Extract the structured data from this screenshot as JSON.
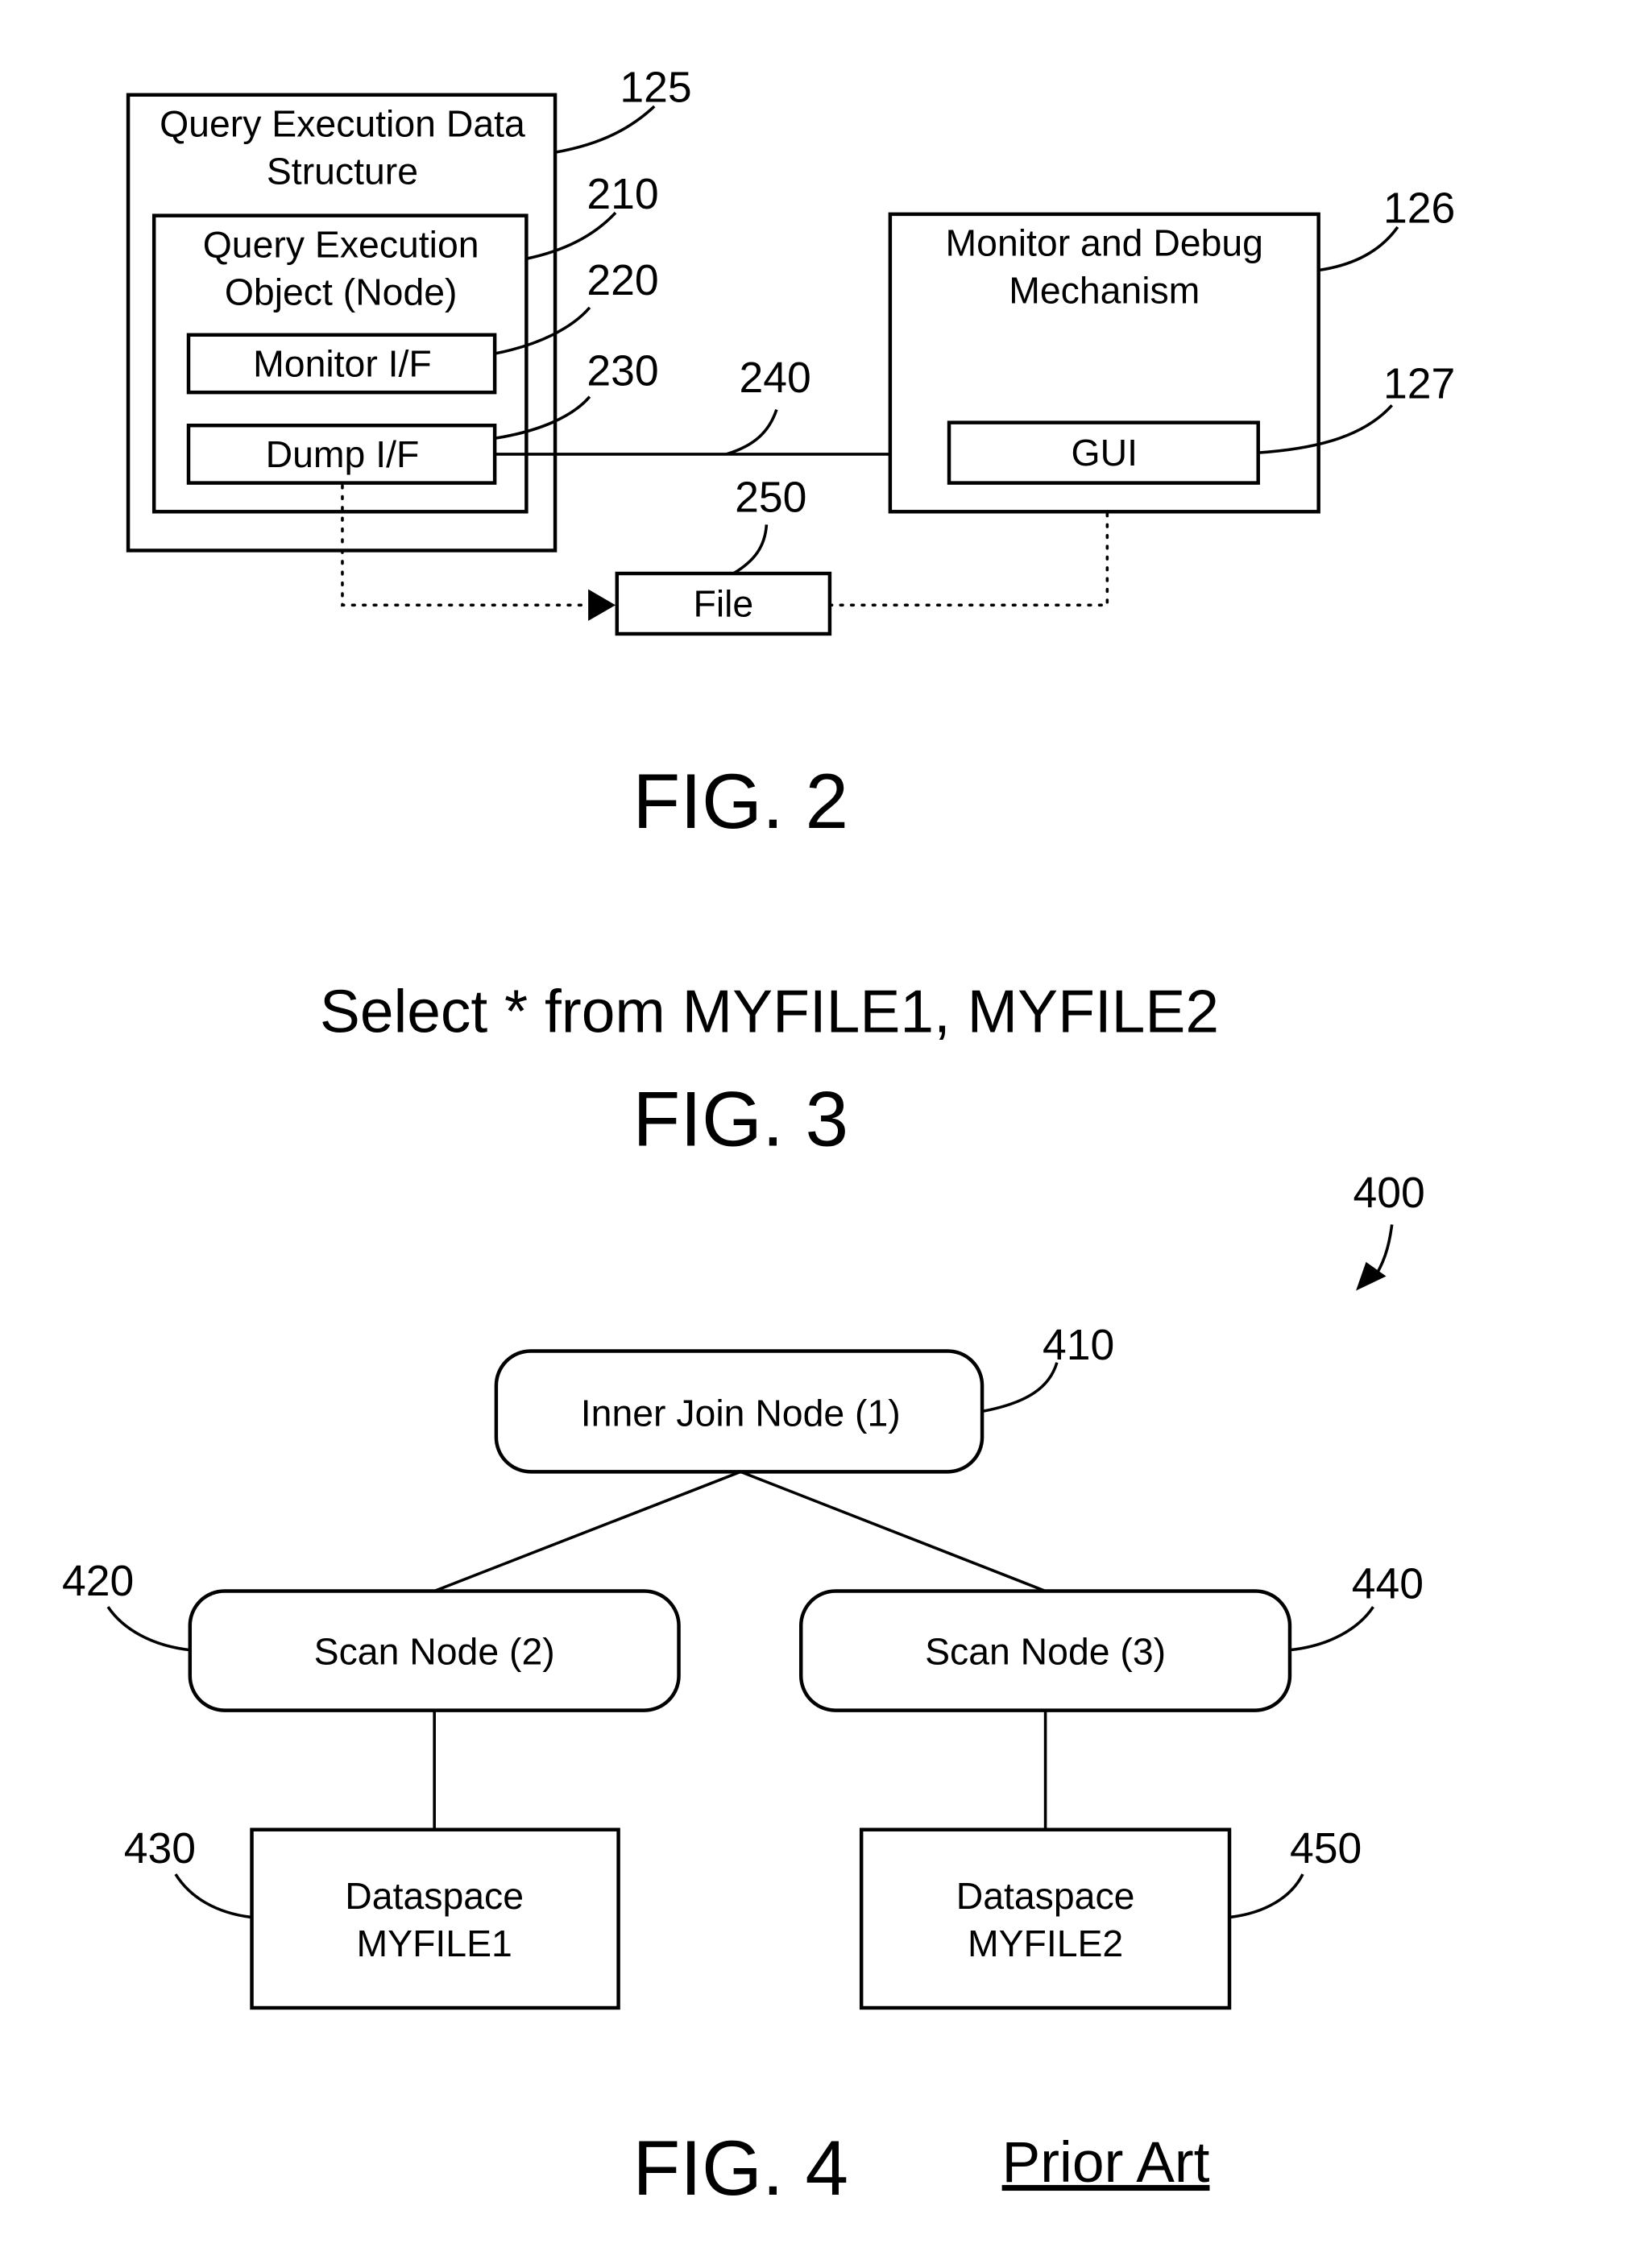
{
  "fig2": {
    "caption": "FIG. 2",
    "query_execution_data_structure": {
      "line1": "Query Execution Data",
      "line2": "Structure",
      "ref": "125"
    },
    "query_execution_object": {
      "line1": "Query Execution",
      "line2": "Object (Node)",
      "ref": "210"
    },
    "monitor_if": {
      "label": "Monitor I/F",
      "ref": "220"
    },
    "dump_if": {
      "label": "Dump I/F",
      "ref": "230"
    },
    "direct_link": {
      "ref": "240"
    },
    "file": {
      "label": "File",
      "ref": "250"
    },
    "monitor_debug": {
      "line1": "Monitor and Debug",
      "line2": "Mechanism",
      "ref": "126"
    },
    "gui": {
      "label": "GUI",
      "ref": "127"
    }
  },
  "fig3": {
    "query": "Select * from MYFILE1, MYFILE2",
    "caption": "FIG. 3"
  },
  "fig4": {
    "caption": "FIG. 4",
    "prior_art": "Prior Art",
    "tree_ref": "400",
    "inner_join": {
      "label": "Inner Join Node (1)",
      "ref": "410"
    },
    "scan_node_2": {
      "label": "Scan Node (2)",
      "ref": "420"
    },
    "scan_node_3": {
      "label": "Scan Node (3)",
      "ref": "440"
    },
    "dataspace_1": {
      "line1": "Dataspace",
      "line2": "MYFILE1",
      "ref": "430"
    },
    "dataspace_2": {
      "line1": "Dataspace",
      "line2": "MYFILE2",
      "ref": "450"
    }
  }
}
